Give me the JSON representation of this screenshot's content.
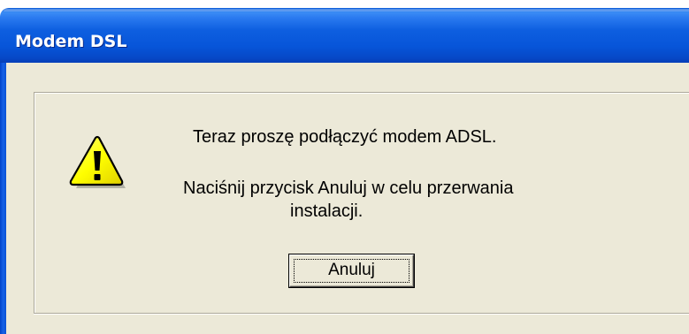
{
  "window": {
    "title": "Modem DSL"
  },
  "dialog": {
    "message_line_1": "Teraz proszę podłączyć modem ADSL.",
    "message_line_2a": "Naciśnij przycisk Anuluj w celu przerwania",
    "message_line_2b": "instalacji.",
    "icon": "warning-icon",
    "cancel_label": "Anuluj"
  },
  "colors": {
    "titlebar": "#0755d9",
    "client_background": "#ece9d8",
    "warning_yellow": "#ffff00"
  }
}
